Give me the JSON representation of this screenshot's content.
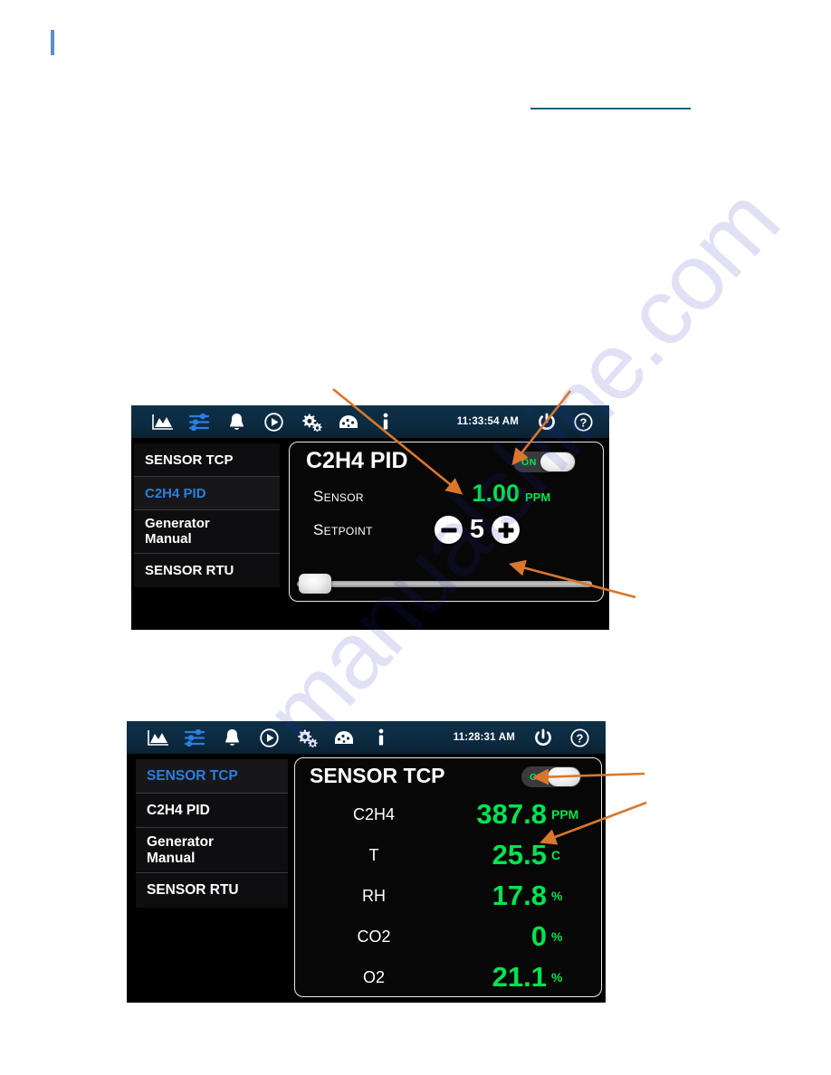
{
  "page": {
    "side_mark_color": "#5b8fc9",
    "rule_color": "#16607e",
    "watermark_text": "manualshine.com"
  },
  "theme": {
    "toolbar_bg": "#0c2b41",
    "accent_blue": "#2a7fe0",
    "value_green": "#00e450",
    "toggle_on_green": "#00e65a",
    "card_border": "#e9e9e9",
    "arrow_orange": "#d9772c"
  },
  "toolbar_icons": [
    {
      "name": "chart-icon",
      "label": "Chart"
    },
    {
      "name": "sliders-icon",
      "label": "Sliders"
    },
    {
      "name": "bell-icon",
      "label": "Alarms"
    },
    {
      "name": "play-circle-icon",
      "label": "Run"
    },
    {
      "name": "gears-icon",
      "label": "Settings"
    },
    {
      "name": "gauge-icon",
      "label": "Gauge"
    },
    {
      "name": "info-icon",
      "label": "Info"
    }
  ],
  "toolbar_right_icons": [
    {
      "name": "power-icon",
      "label": "Power"
    },
    {
      "name": "help-icon",
      "label": "Help"
    }
  ],
  "screen_1": {
    "clock": "11:33:54 AM",
    "sidebar": [
      {
        "label": "SENSOR TCP",
        "selected": false
      },
      {
        "label": "C2H4 PID",
        "selected": true
      },
      {
        "label_line1": "Generator",
        "label_line2": "Manual",
        "selected": false
      },
      {
        "label": "SENSOR RTU",
        "selected": false
      }
    ],
    "card": {
      "title": "C2H4 PID",
      "toggle_label": "ON",
      "toggle_state": "on",
      "rows": [
        {
          "label": "Sensor",
          "value": "1.00",
          "unit": "PPM"
        }
      ],
      "setpoint": {
        "label": "Setpoint",
        "value": "5",
        "minus_label": "−",
        "plus_label": "+"
      },
      "slider": {
        "position_percent": 2
      }
    }
  },
  "screen_2": {
    "clock": "11:28:31 AM",
    "sidebar": [
      {
        "label": "SENSOR TCP",
        "selected": true
      },
      {
        "label": "C2H4 PID",
        "selected": false
      },
      {
        "label_line1": "Generator",
        "label_line2": "Manual",
        "selected": false
      },
      {
        "label": "SENSOR RTU",
        "selected": false
      }
    ],
    "card": {
      "title": "SENSOR TCP",
      "toggle_label": "ON",
      "toggle_state": "on",
      "rows": [
        {
          "label": "C2H4",
          "value": "387.8",
          "unit": "PPM"
        },
        {
          "label": "T",
          "value": "25.5",
          "unit": "C"
        },
        {
          "label": "RH",
          "value": "17.8",
          "unit": "%"
        },
        {
          "label": "CO2",
          "value": "0",
          "unit": "%"
        },
        {
          "label": "O2",
          "value": "21.1",
          "unit": "%"
        }
      ]
    }
  }
}
